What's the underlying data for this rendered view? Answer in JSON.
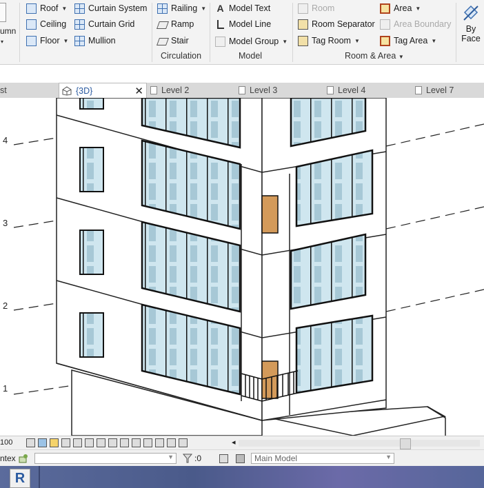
{
  "ribbon": {
    "column_partial": "umn",
    "build": {
      "roof": "Roof",
      "ceiling": "Ceiling",
      "floor": "Floor",
      "curtain_system": "Curtain System",
      "curtain_grid": "Curtain Grid",
      "mullion": "Mullion"
    },
    "circulation": {
      "railing": "Railing",
      "ramp": "Ramp",
      "stair": "Stair",
      "label": "Circulation"
    },
    "model": {
      "model_text": "Model Text",
      "model_line": "Model Line",
      "model_group": "Model Group",
      "label": "Model"
    },
    "room_area": {
      "room": "Room",
      "room_separator": "Room Separator",
      "tag_room": "Tag Room",
      "area": "Area",
      "area_boundary": "Area Boundary",
      "tag_area": "Tag Area",
      "label": "Room & Area"
    },
    "by_face": {
      "line1": "By",
      "line2": "Face"
    }
  },
  "tabs": [
    {
      "label": "st"
    },
    {
      "label": "{3D}"
    },
    {
      "label": "Level 2"
    },
    {
      "label": "Level 3"
    },
    {
      "label": "Level 4"
    },
    {
      "label": "Level 7"
    }
  ],
  "levels": [
    "4",
    "3",
    "2",
    "1"
  ],
  "status": {
    "scale_partial": "100",
    "context_partial": "ntex",
    "filter_count": ":0",
    "workset": "Main Model"
  },
  "taskbar": {
    "app_letter": "R"
  }
}
